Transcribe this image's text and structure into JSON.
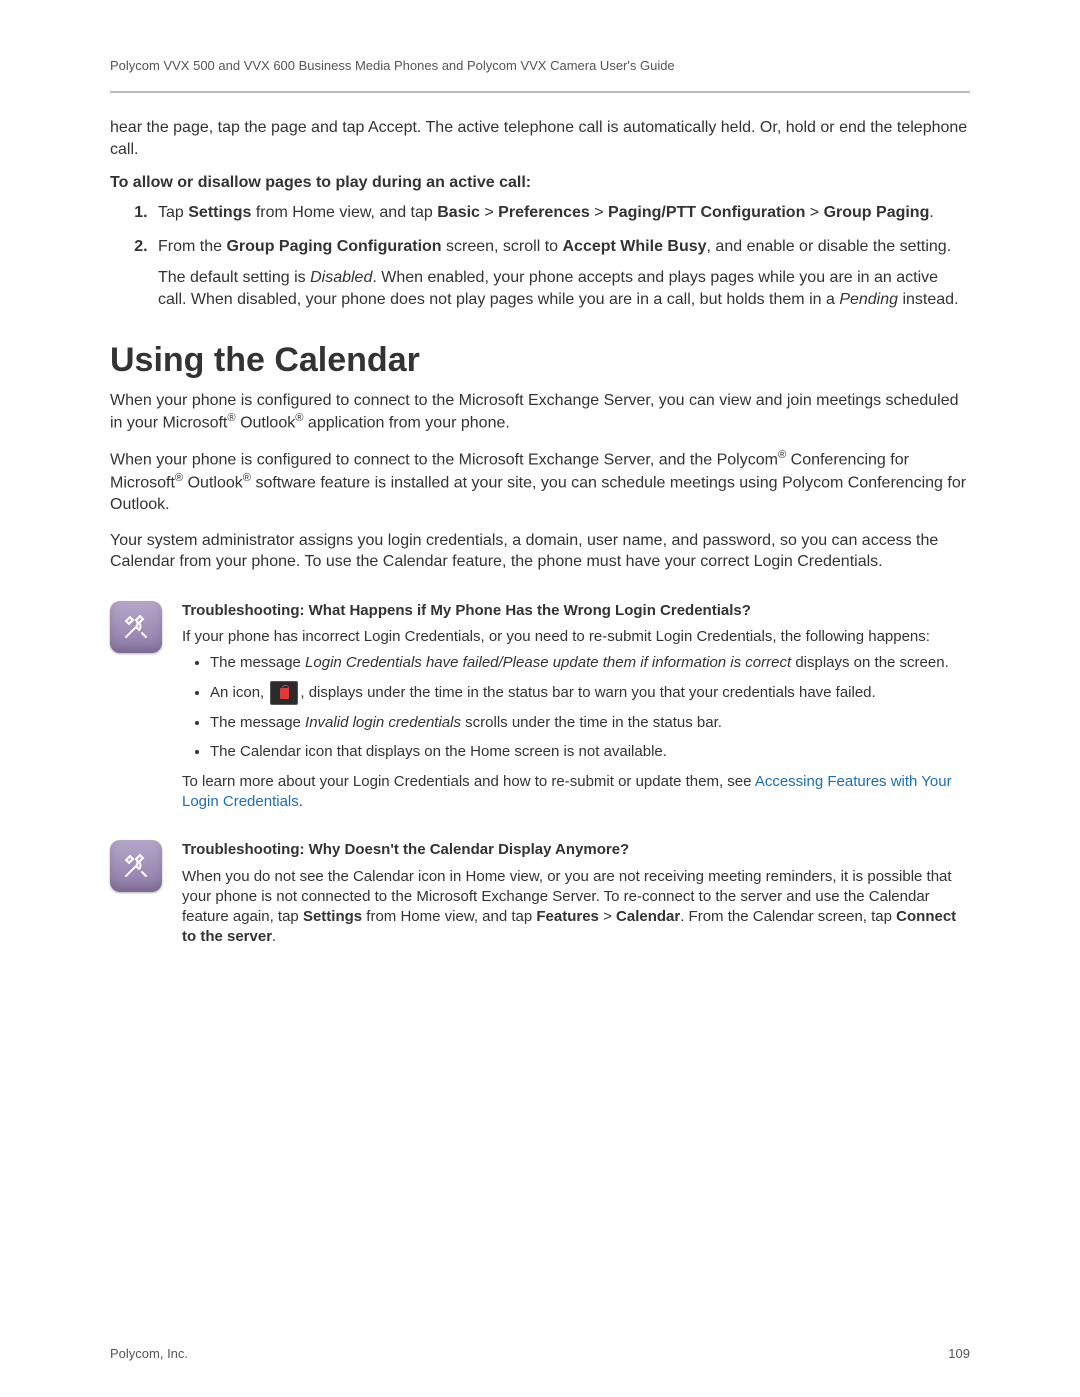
{
  "header": {
    "running_title": "Polycom VVX 500 and VVX 600 Business Media Phones and Polycom VVX Camera User's Guide"
  },
  "intro_para": "hear the page, tap the page and tap Accept. The active telephone call is automatically held. Or, hold or end the telephone call.",
  "procedure": {
    "lead": "To allow or disallow pages to play during an active call:",
    "step1_pre": "Tap ",
    "step1_b1": "Settings",
    "step1_mid1": " from Home view, and tap ",
    "step1_b2": "Basic",
    "step1_gt": " > ",
    "step1_b3": "Preferences",
    "step1_b4": "Paging/PTT Configuration",
    "step1_b5": "Group Paging",
    "step1_end": ".",
    "step2_pre": "From the ",
    "step2_b1": "Group Paging Configuration",
    "step2_mid": " screen, scroll to ",
    "step2_b2": "Accept While Busy",
    "step2_end": ", and enable or disable the setting.",
    "step2_extra_pre": "The default setting is ",
    "step2_extra_em": "Disabled",
    "step2_extra_mid": ". When enabled, your phone accepts and plays pages while you are in an active call. When disabled, your phone does not play pages while you are in a call, but holds them in a ",
    "step2_extra_em2": "Pending",
    "step2_extra_end": " instead."
  },
  "section_heading": "Using the Calendar",
  "para1_pre": "When your phone is configured to connect to the Microsoft Exchange Server, you can view and join meetings scheduled in your Microsoft",
  "para1_reg": "®",
  "para1_mid": " Outlook",
  "para1_end": " application from your phone.",
  "para2_a": "When your phone is configured to connect to the Microsoft Exchange Server, and the Polycom",
  "para2_b": " Conferencing for Microsoft",
  "para2_c": " Outlook",
  "para2_d": " software feature is installed at your site, you can schedule meetings using Polycom Conferencing for Outlook.",
  "para3": "Your system administrator assigns you login credentials, a domain, user name, and password, so you can access the Calendar from your phone. To use the Calendar feature, the phone must have your correct Login Credentials.",
  "callout1": {
    "title": "Troubleshooting: What Happens if My Phone Has the Wrong Login Credentials?",
    "intro": "If your phone has incorrect Login Credentials, or you need to re-submit Login Credentials, the following happens:",
    "b1_pre": "The message ",
    "b1_em": "Login Credentials have failed/Please update them if information is correct",
    "b1_post": " displays on the screen.",
    "b2_pre": "An icon, ",
    "b2_post": ", displays under the time in the status bar to warn you that your credentials have failed.",
    "b3_pre": "The message ",
    "b3_em": "Invalid login credentials",
    "b3_post": " scrolls under the time in the status bar.",
    "b4": "The Calendar icon that displays on the Home screen is not available.",
    "out_pre": "To learn more about your Login Credentials and how to re-submit or update them, see ",
    "out_link": "Accessing Features with Your Login Credentials",
    "out_post": "."
  },
  "callout2": {
    "title": "Troubleshooting: Why Doesn't the Calendar Display Anymore?",
    "body_pre": "When you do not see the Calendar icon in Home view, or you are not receiving meeting reminders, it is possible that your phone is not connected to the Microsoft Exchange Server. To re-connect to the server and use the Calendar feature again, tap ",
    "b1": "Settings",
    "mid1": " from Home view, and tap ",
    "b2": "Features",
    "gt": " > ",
    "b3": "Calendar",
    "mid2": ". From the Calendar screen, tap ",
    "b4": "Connect to the server",
    "end": "."
  },
  "footer": {
    "company": "Polycom, Inc.",
    "page_number": "109"
  }
}
